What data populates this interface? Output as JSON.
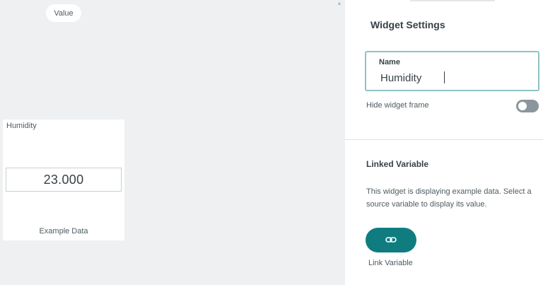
{
  "canvas": {
    "value_pill_label": "Value",
    "widget": {
      "title": "Humidity",
      "value": "23.000",
      "footer": "Example Data"
    }
  },
  "panel": {
    "title": "Widget Settings",
    "name_field": {
      "label": "Name",
      "value": "Humidity"
    },
    "hide_frame": {
      "label": "Hide widget frame",
      "enabled": false
    },
    "linked_variable": {
      "title": "Linked Variable",
      "description": "This widget is displaying example data. Select a source variable to display its value.",
      "button_icon": "link-icon",
      "button_caption": "Link Variable"
    }
  },
  "colors": {
    "accent": "#0f7c80",
    "field_focus_border": "#8fc3c4",
    "toggle_off": "#8a969b",
    "canvas_bg": "#eef0f1"
  }
}
